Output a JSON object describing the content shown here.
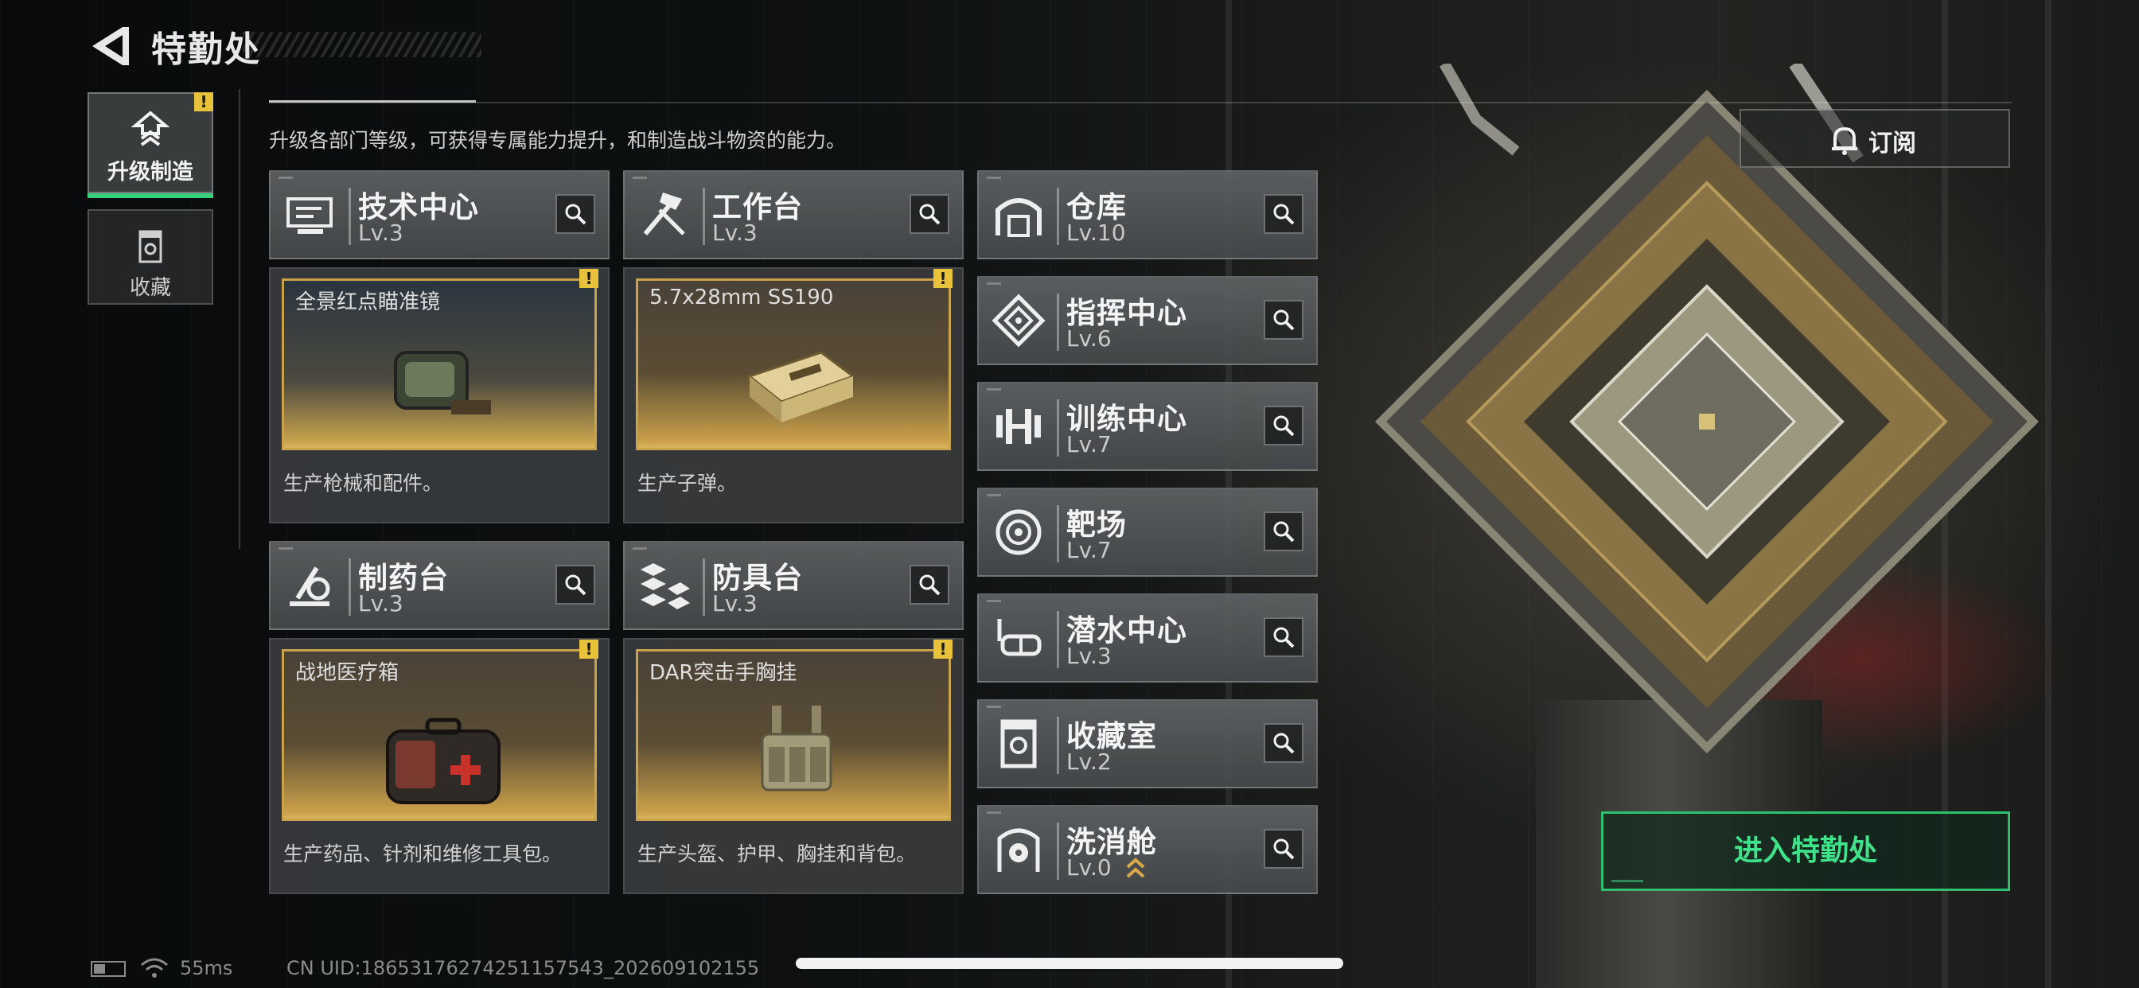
{
  "header": {
    "title": "特勤处",
    "description": "升级各部门等级，可获得专属能力提升，和制造战斗物资的能力。"
  },
  "sidebar": {
    "items": [
      {
        "label": "升级制造",
        "active": true,
        "icon": "upgrade-icon",
        "warning": "!"
      },
      {
        "label": "收藏",
        "active": false,
        "icon": "collection-icon"
      }
    ]
  },
  "facilities": {
    "tech_center": {
      "name": "技术中心",
      "level": "Lv.3",
      "icon": "tech-center-icon",
      "product": {
        "name": "全景红点瞄准镜",
        "warning": "!"
      },
      "description": "生产枪械和配件。"
    },
    "workbench": {
      "name": "工作台",
      "level": "Lv.3",
      "icon": "workbench-icon",
      "product": {
        "name": "5.7x28mm SS190",
        "warning": "!"
      },
      "description": "生产子弹。"
    },
    "pharmacy": {
      "name": "制药台",
      "level": "Lv.3",
      "icon": "pharmacy-icon",
      "product": {
        "name": "战地医疗箱",
        "warning": "!"
      },
      "description": "生产药品、针剂和维修工具包。"
    },
    "armor_bench": {
      "name": "防具台",
      "level": "Lv.3",
      "icon": "armor-bench-icon",
      "product": {
        "name": "DAR突击手胸挂",
        "warning": "!"
      },
      "description": "生产头盔、护甲、胸挂和背包。"
    },
    "list": [
      {
        "name": "仓库",
        "level": "Lv.10",
        "icon": "warehouse-icon"
      },
      {
        "name": "指挥中心",
        "level": "Lv.6",
        "icon": "command-center-icon"
      },
      {
        "name": "训练中心",
        "level": "Lv.7",
        "icon": "training-center-icon"
      },
      {
        "name": "靶场",
        "level": "Lv.7",
        "icon": "shooting-range-icon"
      },
      {
        "name": "潜水中心",
        "level": "Lv.3",
        "icon": "diving-center-icon"
      },
      {
        "name": "收藏室",
        "level": "Lv.2",
        "icon": "collection-room-icon"
      },
      {
        "name": "洗消舱",
        "level": "Lv.0",
        "icon": "decontamination-icon",
        "upgrade_hint": "upgrade-chevron-icon"
      }
    ]
  },
  "actions": {
    "subscribe_label": "订阅",
    "enter_label": "进入特勤处"
  },
  "status": {
    "ping": "55ms",
    "uid": "CN UID:18653176274251157543_20260910​2155"
  },
  "colors": {
    "accent_green": "#3ee38a",
    "warning_yellow": "#e8c23a",
    "product_gold": "#c9a24a"
  }
}
